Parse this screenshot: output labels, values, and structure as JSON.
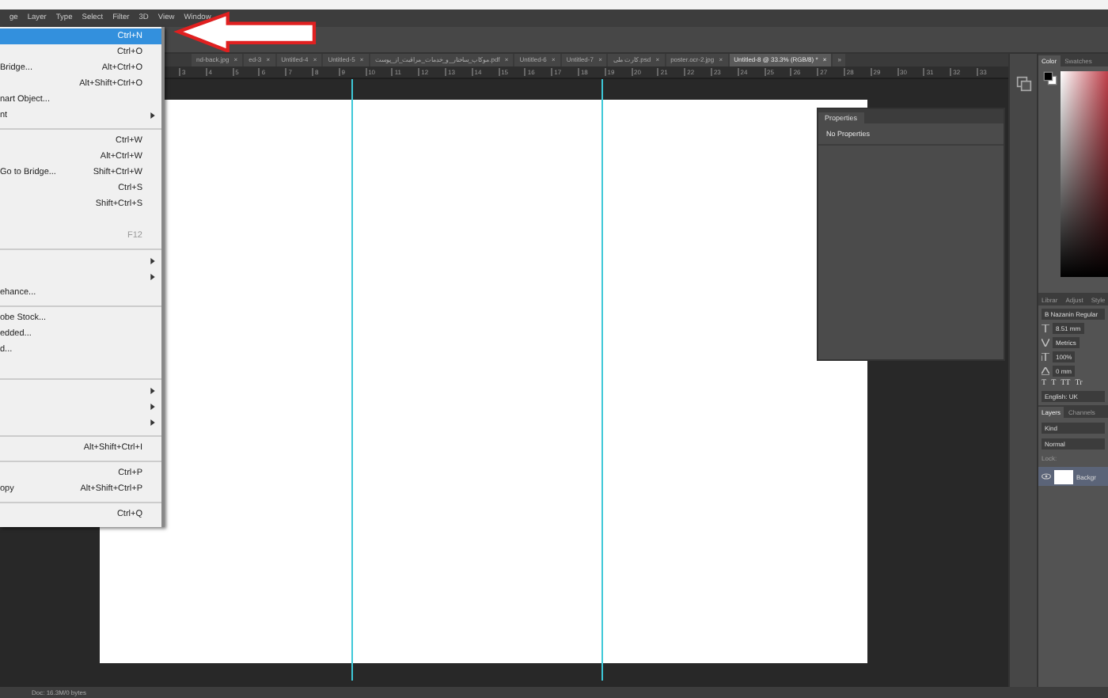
{
  "menu_bar": [
    "ge",
    "Layer",
    "Type",
    "Select",
    "Filter",
    "3D",
    "View",
    "Window"
  ],
  "file_menu": [
    {
      "kind": "item",
      "shortcut": "Ctrl+N",
      "submenu": false,
      "disabled": false,
      "selected": true
    },
    {
      "kind": "item",
      "shortcut": "Ctrl+O",
      "submenu": false,
      "disabled": false,
      "selected": false
    },
    {
      "kind": "item",
      "label": "Bridge...",
      "shortcut": "Alt+Ctrl+O",
      "submenu": false,
      "disabled": false,
      "selected": false
    },
    {
      "kind": "item",
      "shortcut": "Alt+Shift+Ctrl+O",
      "submenu": false,
      "disabled": false,
      "selected": false
    },
    {
      "kind": "item",
      "label": "nart Object...",
      "submenu": false,
      "disabled": false,
      "selected": false
    },
    {
      "kind": "item",
      "label": "nt",
      "submenu": true,
      "disabled": false,
      "selected": false
    },
    {
      "kind": "separator"
    },
    {
      "kind": "item",
      "shortcut": "Ctrl+W",
      "submenu": false,
      "disabled": false,
      "selected": false
    },
    {
      "kind": "item",
      "shortcut": "Alt+Ctrl+W",
      "submenu": false,
      "disabled": false,
      "selected": false
    },
    {
      "kind": "item",
      "label": "Go to Bridge...",
      "shortcut": "Shift+Ctrl+W",
      "submenu": false,
      "disabled": false,
      "selected": false
    },
    {
      "kind": "item",
      "shortcut": "Ctrl+S",
      "submenu": false,
      "disabled": false,
      "selected": false
    },
    {
      "kind": "item",
      "shortcut": "Shift+Ctrl+S",
      "submenu": false,
      "disabled": false,
      "selected": false
    },
    {
      "kind": "blank"
    },
    {
      "kind": "item",
      "shortcut": "F12",
      "submenu": false,
      "disabled": true,
      "selected": false
    },
    {
      "kind": "separator"
    },
    {
      "kind": "item",
      "submenu": true,
      "disabled": false,
      "selected": false
    },
    {
      "kind": "item",
      "submenu": true,
      "disabled": false,
      "selected": false
    },
    {
      "kind": "item",
      "label": "ehance...",
      "submenu": false,
      "disabled": false,
      "selected": false
    },
    {
      "kind": "separator"
    },
    {
      "kind": "item",
      "label": "obe Stock...",
      "submenu": false,
      "disabled": false,
      "selected": false
    },
    {
      "kind": "item",
      "label": "edded...",
      "submenu": false,
      "disabled": false,
      "selected": false
    },
    {
      "kind": "item",
      "label": "d...",
      "submenu": false,
      "disabled": false,
      "selected": false
    },
    {
      "kind": "blank"
    },
    {
      "kind": "separator"
    },
    {
      "kind": "item",
      "submenu": true,
      "disabled": false,
      "selected": false
    },
    {
      "kind": "item",
      "submenu": true,
      "disabled": false,
      "selected": false
    },
    {
      "kind": "item",
      "submenu": true,
      "disabled": false,
      "selected": false
    },
    {
      "kind": "separator"
    },
    {
      "kind": "item",
      "shortcut": "Alt+Shift+Ctrl+I",
      "submenu": false,
      "disabled": false,
      "selected": false
    },
    {
      "kind": "separator"
    },
    {
      "kind": "item",
      "shortcut": "Ctrl+P",
      "submenu": false,
      "disabled": false,
      "selected": false
    },
    {
      "kind": "item",
      "label": "opy",
      "shortcut": "Alt+Shift+Ctrl+P",
      "submenu": false,
      "disabled": false,
      "selected": false
    },
    {
      "kind": "separator"
    },
    {
      "kind": "item",
      "shortcut": "Ctrl+Q",
      "submenu": false,
      "disabled": false,
      "selected": false
    }
  ],
  "document_tabs": [
    {
      "label": "nd-back.jpg",
      "close": "×",
      "selected": false
    },
    {
      "label": "ed-3",
      "close": "×",
      "selected": false
    },
    {
      "label": "Untitled-4",
      "close": "×",
      "selected": false
    },
    {
      "label": "Untitled-5",
      "close": "×",
      "selected": false
    },
    {
      "label": "موکاپ_ساختار_و_خدمات_مراقبت_از_پوست.pdf",
      "close": "×",
      "selected": false
    },
    {
      "label": "Untitled-6",
      "close": "×",
      "selected": false
    },
    {
      "label": "Untitled-7",
      "close": "×",
      "selected": false
    },
    {
      "label": "کارت ملی.psd",
      "close": "×",
      "selected": false
    },
    {
      "label": "poster.ocr-2.jpg",
      "close": "×",
      "selected": false
    },
    {
      "label": "Untitled-8 @ 33.3% (RGB/8) *",
      "close": "×",
      "selected": true
    }
  ],
  "tabs_overflow": "»",
  "ruler": [
    "3",
    "4",
    "5",
    "6",
    "7",
    "8",
    "9",
    "10",
    "11",
    "12",
    "13",
    "14",
    "15",
    "16",
    "17",
    "18",
    "19",
    "20",
    "21",
    "22",
    "23",
    "24",
    "25",
    "26",
    "27",
    "28",
    "29",
    "30",
    "31",
    "32",
    "33"
  ],
  "properties_panel": {
    "tab": "Properties",
    "text": "No Properties"
  },
  "color_panel": {
    "tabs": [
      {
        "label": "Color",
        "selected": true
      },
      {
        "label": "Swatches",
        "selected": false
      }
    ]
  },
  "library_tabs": [
    {
      "label": "Librar",
      "selected": false
    },
    {
      "label": "Adjust",
      "selected": false
    },
    {
      "label": "Style",
      "selected": false
    }
  ],
  "character_panel": {
    "font": "B Nazanin Regular",
    "size": "8.51 mm",
    "kerning": "Metrics",
    "scale": "100%",
    "baseline": "0 mm",
    "styles": [
      "T",
      "T",
      "TT",
      "Tr"
    ],
    "language": "English: UK"
  },
  "layers_panel": {
    "tabs": [
      {
        "label": "Layers",
        "selected": true
      },
      {
        "label": "Channels",
        "selected": false
      }
    ],
    "filter": "Kind",
    "blend": "Normal",
    "lock": "Lock:",
    "layer": "Backgr"
  },
  "status_bar": "Doc: 16.3M/0 bytes"
}
